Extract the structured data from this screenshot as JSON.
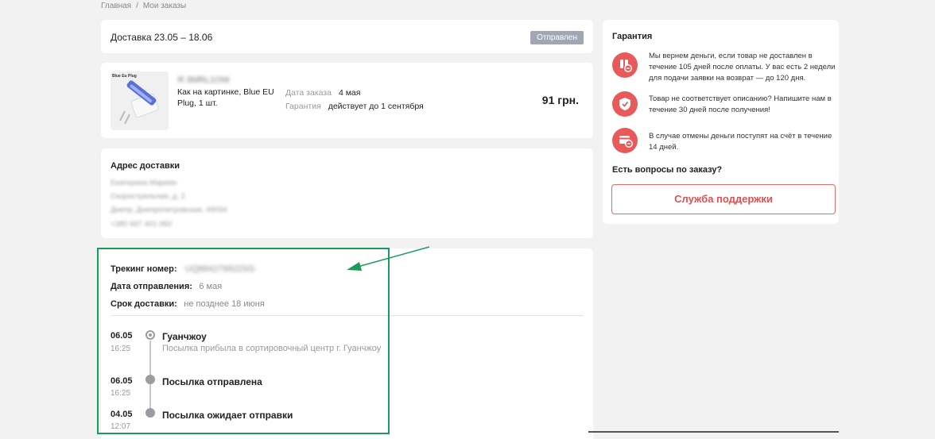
{
  "breadcrumb": {
    "home": "Главная",
    "separator": "/",
    "current": "Мои заказы"
  },
  "delivery": {
    "title": "Доставка 23.05 – 18.06",
    "status": "Отправлен"
  },
  "product": {
    "thumb_text": "Blue Eu Plug",
    "sku_blurred": "Я ЗМRL1OW",
    "desc_line1": "Как на картинке, Blue EU",
    "desc_line2": "Plug, 1 шт.",
    "order_date_label": "Дата заказа",
    "order_date": "4 мая",
    "guarantee_label": "Гарантия",
    "guarantee_value": "действует до 1 сентября",
    "price": "91 грн."
  },
  "address": {
    "title": "Адрес доставки",
    "lines": [
      "Екатерина Мариян",
      "Скорострельная, д. 2",
      "Днепр, Днепропетровская, 49034",
      "+380 667 401 060"
    ]
  },
  "tracking": {
    "number_label": "Трекинг номер:",
    "number_value": "UQ884279922SG",
    "sent_label": "Дата отправления:",
    "sent_value": "6 мая",
    "term_label": "Срок доставки:",
    "term_value": "не позднее 18 июня",
    "events": [
      {
        "date": "06.05",
        "time": "16:25",
        "title": "Гуанчжоу",
        "subtitle": "Посылка прибыла в сортировочный центр г. Гуанчжоу"
      },
      {
        "date": "06.05",
        "time": "16:25",
        "title": "Посылка отправлена",
        "subtitle": ""
      },
      {
        "date": "04.05",
        "time": "12:07",
        "title": "Посылка ожидает отправки",
        "subtitle": ""
      }
    ]
  },
  "guarantee": {
    "title": "Гарантия",
    "items": [
      {
        "icon": "parcel-return-icon",
        "text": "Мы вернем деньги, если товар не доставлен в течение 105 дней после оплаты. У вас есть 2 недели для подачи заявки на возврат — до 120 дня."
      },
      {
        "icon": "shield-icon",
        "text": "Товар не соответствует описанию? Напишите нам в течение 30 дней после получения!"
      },
      {
        "icon": "card-refund-icon",
        "text": "В случае отмены деньги поступят на счёт в течение 14 дней."
      }
    ],
    "question": "Есть вопросы по заказу?",
    "support_button": "Служба поддержки"
  },
  "colors": {
    "annotation_green": "#1a9a5c",
    "accent_red": "#e85a5a",
    "badge_gray": "#a2a5b5"
  }
}
